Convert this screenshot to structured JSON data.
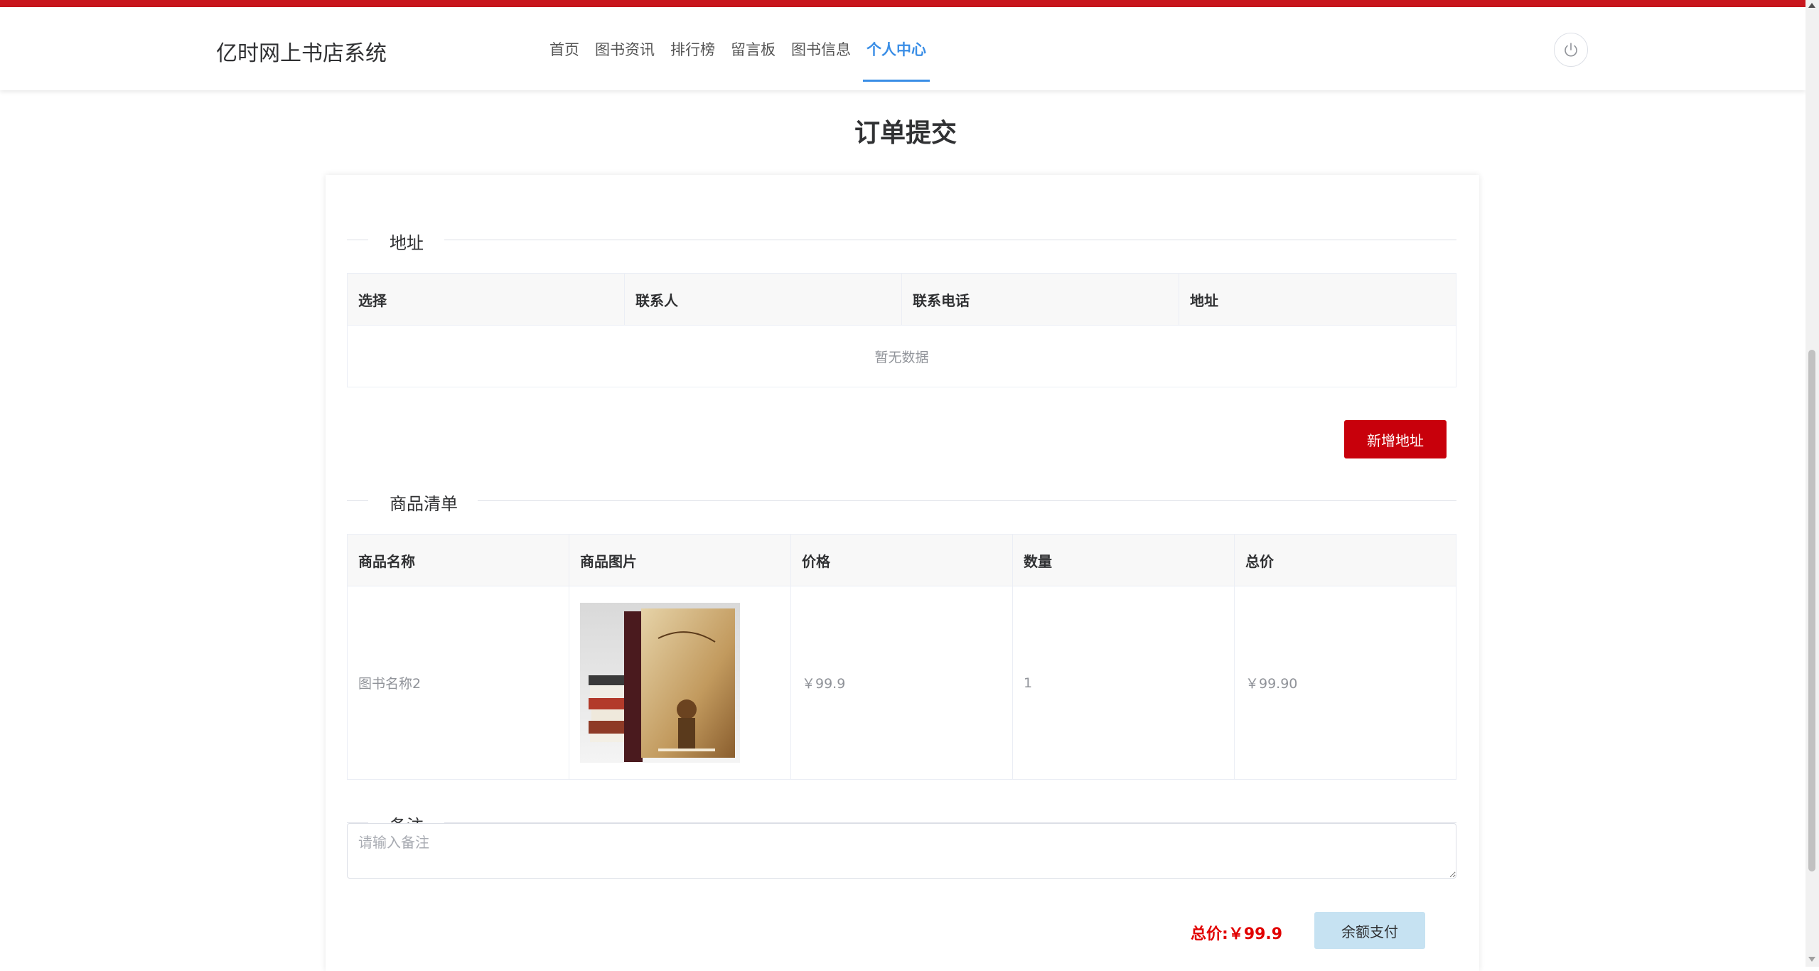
{
  "header": {
    "logo": "亿时网上书店系统",
    "nav": [
      "首页",
      "图书资讯",
      "排行榜",
      "留言板",
      "图书信息",
      "个人中心"
    ],
    "active_nav": "个人中心"
  },
  "page_title": "订单提交",
  "address_section": {
    "title": "地址",
    "columns": [
      "选择",
      "联系人",
      "联系电话",
      "地址"
    ],
    "empty_text": "暂无数据",
    "add_button": "新增地址"
  },
  "goods_section": {
    "title": "商品清单",
    "columns": [
      "商品名称",
      "商品图片",
      "价格",
      "数量",
      "总价"
    ],
    "rows": [
      {
        "name": "图书名称2",
        "image": "book-cover",
        "price": "￥99.9",
        "quantity": "1",
        "subtotal": "￥99.90"
      }
    ]
  },
  "remark_section": {
    "title": "备注",
    "placeholder": "请输入备注"
  },
  "footer": {
    "total_label": "总价:",
    "total_value": "￥99.9",
    "pay_button": "余额支付"
  },
  "colors": {
    "brand_red": "#c8161d",
    "button_red": "#c8000b",
    "active_blue": "#3a8ee6",
    "price_red": "#e10000",
    "pay_button_bg": "#c6e2f2"
  }
}
